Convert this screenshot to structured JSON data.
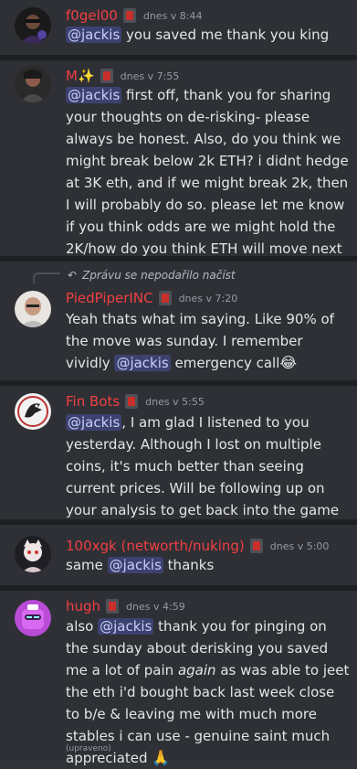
{
  "messages": [
    {
      "username": "f0gel00",
      "badge_icon": "server-tag-icon",
      "timestamp": "dnes v 8:44",
      "mention": "@jackis",
      "text": " you saved me thank you king"
    },
    {
      "username": "M✨",
      "badge_icon": "server-tag-icon",
      "timestamp": "dnes v 7:55",
      "mention": "@jackis",
      "text": " first off, thank you for sharing your thoughts on de-risking- please always be honest. Also, do you think we might break below 2k ETH? i didnt hedge at 3K eth, and if we might break 2k, then I will probably do so. please let me know if you think odds are we might hold the 2K/how do you think ETH will move next"
    },
    {
      "reply_text": "Zprávu se nepodařilo načíst",
      "username": "PiedPiperINC",
      "badge_icon": "server-tag-icon",
      "timestamp": "dnes v 7:20",
      "text_before": "Yeah thats what im saying. Like 90% of the move was sunday. I remember vividly ",
      "mention": "@jackis",
      "text_after": " emergency call",
      "emoji": "😂"
    },
    {
      "username": "Fin Bots",
      "badge_icon": "server-tag-icon",
      "timestamp": "dnes v 5:55",
      "mention": "@jackis",
      "text": ", I am glad I listened to you yesterday. Although I lost on multiple coins, it's much better than seeing current prices. Will be following up on your analysis to get back into the game in next few weeks."
    },
    {
      "username": "100xgk (networth/nuking)",
      "badge_icon": "server-tag-icon",
      "timestamp": "dnes v 5:00",
      "text_before": "same ",
      "mention": "@jackis",
      "text_after": " thanks"
    },
    {
      "username": "hugh",
      "badge_icon": "server-tag-icon",
      "timestamp": "dnes v 4:59",
      "text_before": "also ",
      "mention": "@jackis",
      "text_mid": " thank you for pinging on the sunday about derisking you saved me a lot of pain ",
      "italic": "again",
      "text_after": " as was able to jeet the eth i'd bought back last week close to b/e & leaving me with much more stables i can use  - genuine saint much appreciated ",
      "emoji": "🙏",
      "edited": "(upraveno)"
    }
  ]
}
